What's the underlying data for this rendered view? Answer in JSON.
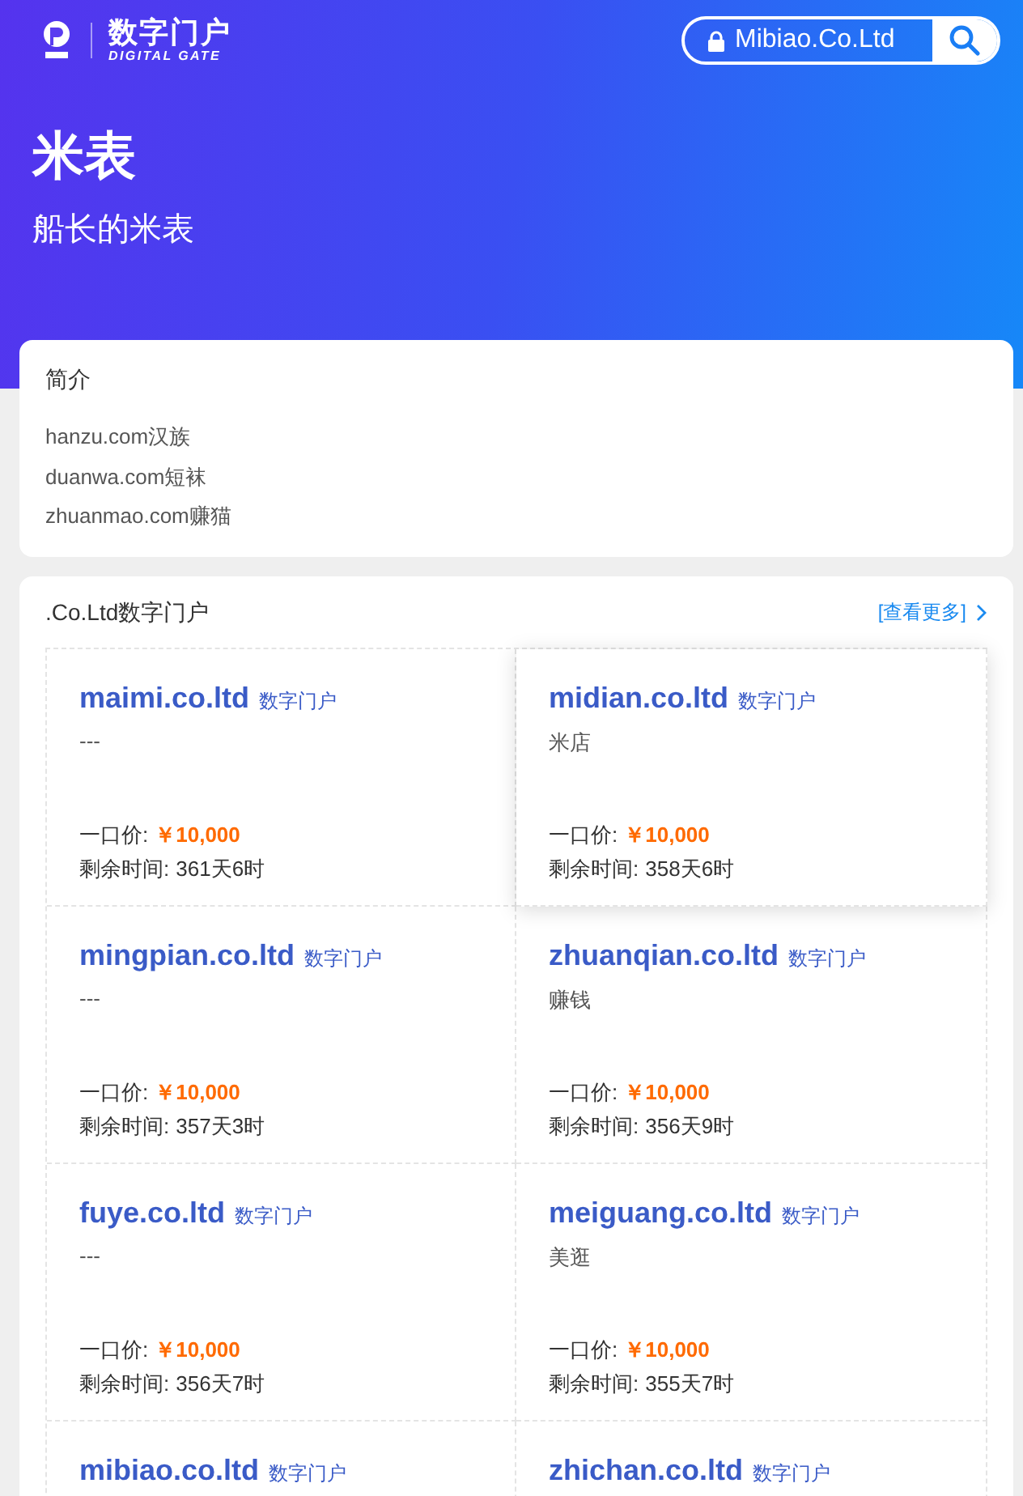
{
  "header": {
    "logo_title": "数字门户",
    "logo_subtitle": "DIGITAL GATE",
    "search": {
      "value": "Mibiao.Co.Ltd"
    }
  },
  "hero": {
    "title": "米表",
    "subtitle": "船长的米表"
  },
  "intro": {
    "title": "简介",
    "lines": [
      "hanzu.com汉族",
      "duanwa.com短袜",
      "zhuanmao.com赚猫"
    ]
  },
  "listing": {
    "title": ".Co.Ltd数字门户",
    "more_link": "[查看更多]",
    "items": [
      {
        "domain": "maimi.co.ltd",
        "tag": "数字门户",
        "description": "---",
        "price_label": "一口价:",
        "price": "￥10,000",
        "time_label": "剩余时间:",
        "time": "361天6时",
        "selected": false
      },
      {
        "domain": "midian.co.ltd",
        "tag": "数字门户",
        "description": "米店",
        "price_label": "一口价:",
        "price": "￥10,000",
        "time_label": "剩余时间:",
        "time": "358天6时",
        "selected": true
      },
      {
        "domain": "mingpian.co.ltd",
        "tag": "数字门户",
        "description": "---",
        "price_label": "一口价:",
        "price": "￥10,000",
        "time_label": "剩余时间:",
        "time": "357天3时",
        "selected": false
      },
      {
        "domain": "zhuanqian.co.ltd",
        "tag": "数字门户",
        "description": "赚钱",
        "price_label": "一口价:",
        "price": "￥10,000",
        "time_label": "剩余时间:",
        "time": "356天9时",
        "selected": false
      },
      {
        "domain": "fuye.co.ltd",
        "tag": "数字门户",
        "description": "---",
        "price_label": "一口价:",
        "price": "￥10,000",
        "time_label": "剩余时间:",
        "time": "356天7时",
        "selected": false
      },
      {
        "domain": "meiguang.co.ltd",
        "tag": "数字门户",
        "description": "美逛",
        "price_label": "一口价:",
        "price": "￥10,000",
        "time_label": "剩余时间:",
        "time": "355天7时",
        "selected": false
      },
      {
        "domain": "mibiao.co.ltd",
        "tag": "数字门户",
        "selected": false
      },
      {
        "domain": "zhichan.co.ltd",
        "tag": "数字门户",
        "selected": false
      }
    ]
  }
}
